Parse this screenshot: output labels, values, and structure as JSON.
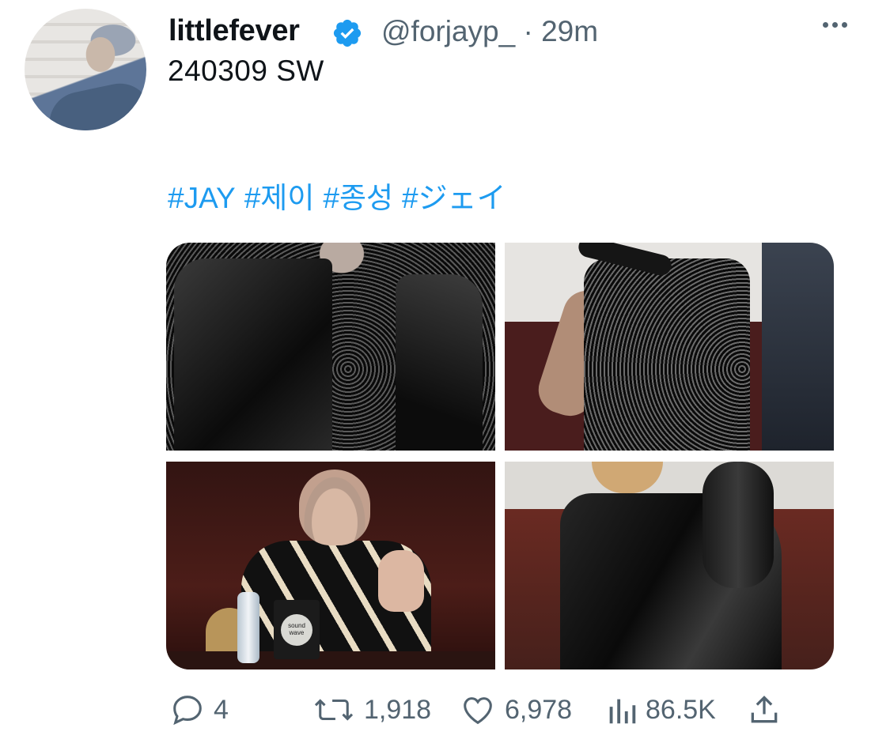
{
  "tweet": {
    "author_name": "littlefever",
    "handle": "@forjayp_",
    "separator": "·",
    "time": "29m",
    "text": "240309 SW",
    "hashtags": [
      "#JAY",
      "#제이",
      "#종성",
      "#ジェイ"
    ]
  },
  "stats": {
    "replies": "4",
    "retweets": "1,918",
    "likes": "6,978",
    "views": "86.5K"
  },
  "photo_text": {
    "sign": "sound wave"
  },
  "colors": {
    "accent": "#1d9bf0",
    "text": "#0f1419",
    "muted": "#536471"
  },
  "icons": [
    "verified-badge-icon",
    "more-options-icon",
    "reply-icon",
    "retweet-icon",
    "like-icon",
    "views-icon",
    "share-icon"
  ]
}
